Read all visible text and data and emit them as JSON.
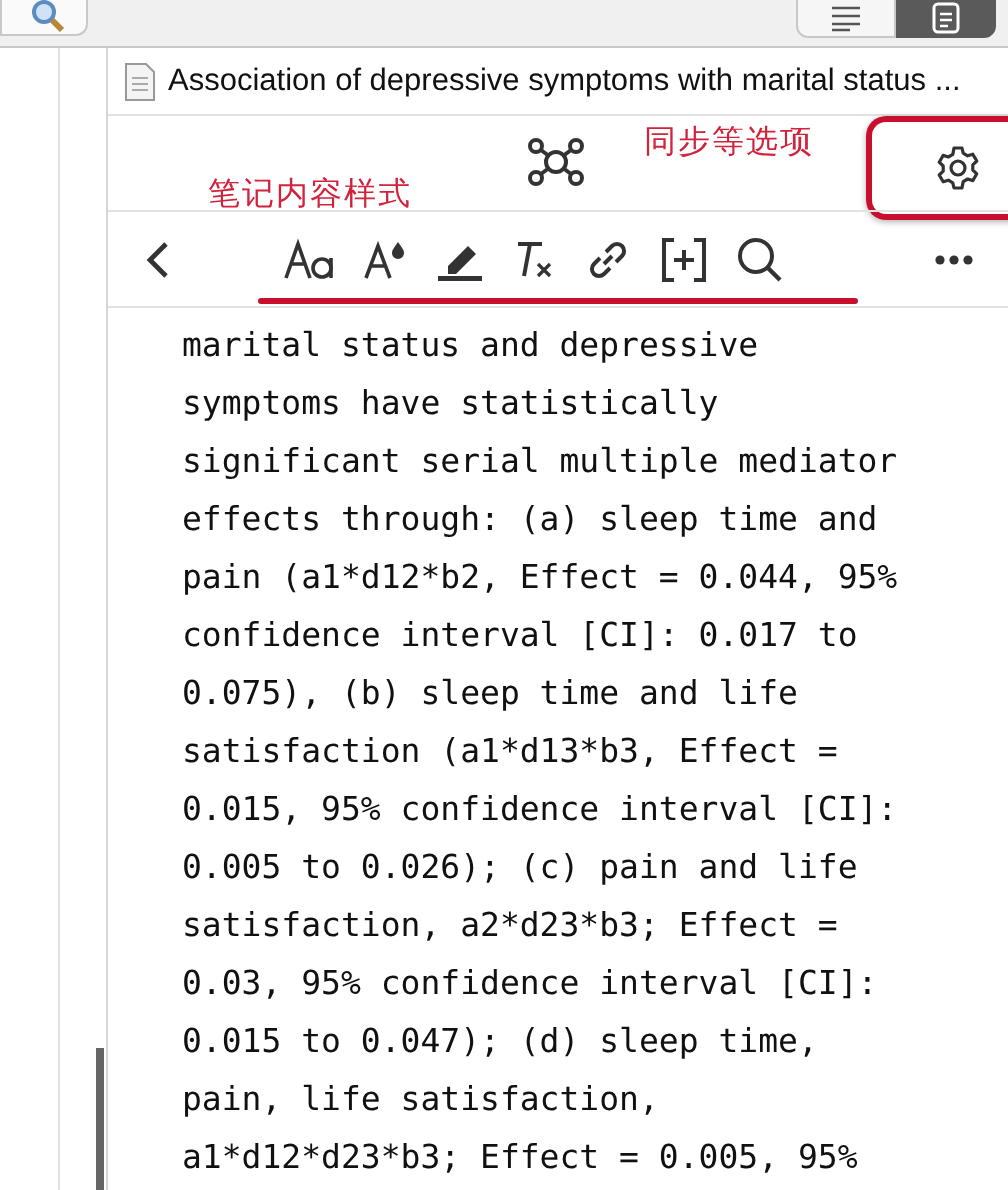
{
  "view_buttons": [
    {
      "kind": "list",
      "selected": false
    },
    {
      "kind": "note",
      "selected": true
    }
  ],
  "document": {
    "title": "Association of depressive symptoms with marital status ..."
  },
  "annotations": {
    "options": "同步等选项",
    "styles": "笔记内容样式"
  },
  "note": {
    "lines": [
      "marital status and depressive",
      "symptoms have statistically",
      "significant serial multiple mediator",
      "effects through: (a) sleep time and",
      "pain (a1*d12*b2, Effect = 0.044, 95%",
      "confidence interval [CI]: 0.017 to",
      "0.075), (b) sleep time and life",
      "satisfaction (a1*d13*b3, Effect =",
      "0.015, 95% confidence interval [CI]:",
      "0.005 to 0.026); (c) pain and life",
      "satisfaction, a2*d23*b3; Effect =",
      "0.03, 95% confidence interval [CI]:",
      "0.015 to 0.047); (d) sleep time,",
      "pain, life satisfaction,",
      "a1*d12*d23*b3; Effect = 0.005, 95%"
    ]
  }
}
